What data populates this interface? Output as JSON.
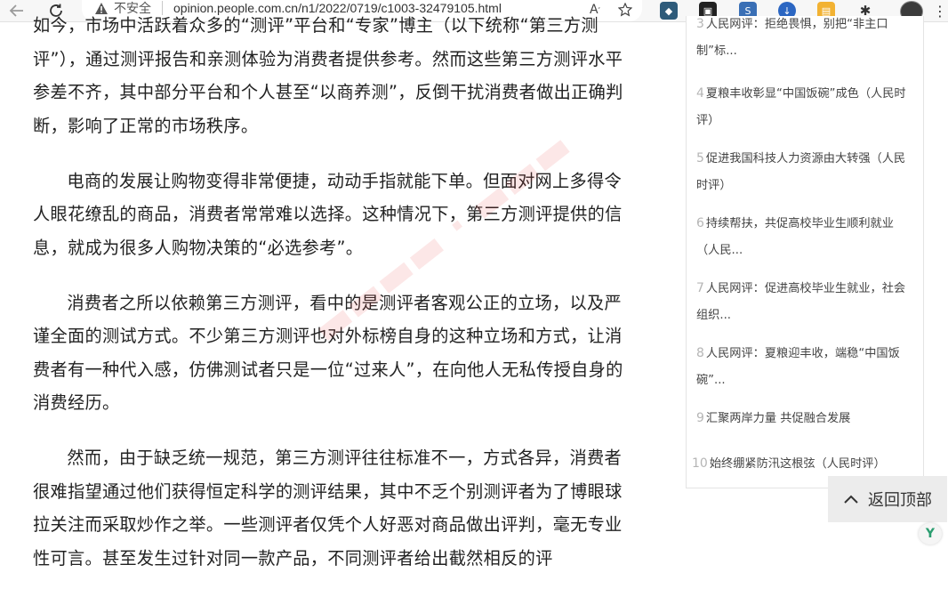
{
  "browser": {
    "security_label": "不安全",
    "url": "opinion.people.com.cn/n1/2022/0719/c1003-32479105.html"
  },
  "article": {
    "paragraphs": [
      "如今，市场中活跃着众多的“测评”平台和“专家”博主（以下统称“第三方测评”），通过测评报告和亲测体验为消费者提供参考。然而这些第三方测评水平参差不齐，其中部分平台和个人甚至“以商养测”，反倒干扰消费者做出正确判断，影响了正常的市场秩序。",
      "电商的发展让购物变得非常便捷，动动手指就能下单。但面对网上多得令人眼花缭乱的商品，消费者常常难以选择。这种情况下，第三方测评提供的信息，就成为很多人购物决策的“必选参考”。",
      "消费者之所以依赖第三方测评，看中的是测评者客观公正的立场，以及严谨全面的测试方式。不少第三方测评也对外标榜自身的这种立场和方式，让消费者有一种代入感，仿佛测试者只是一位“过来人”，在向他人无私传授自身的消费经历。",
      "然而，由于缺乏统一规范，第三方测评往往标准不一，方式各异，消费者很难指望通过他们获得恒定科学的测评结果，其中不乏个别测评者为了博眼球拉关注而采取炒作之举。一些测评者仅凭个人好恶对商品做出评判，毫无专业性可言。甚至发生过针对同一款产品，不同测评者给出截然相反的评"
    ]
  },
  "sidebar": {
    "items": [
      {
        "num": "3",
        "text": "人民网评：拒绝畏惧，别把“非主口制”标..."
      },
      {
        "num": "4",
        "text": "夏粮丰收彰显“中国饭碗”成色（人民时评）"
      },
      {
        "num": "5",
        "text": "促进我国科技人力资源由大转强（人民时评）"
      },
      {
        "num": "6",
        "text": "持续帮扶，共促高校毕业生顺利就业（人民..."
      },
      {
        "num": "7",
        "text": "人民网评：促进高校毕业生就业，社会组织..."
      },
      {
        "num": "8",
        "text": "人民网评：夏粮迎丰收，端稳“中国饭碗”..."
      },
      {
        "num": "9",
        "text": "汇聚两岸力量 共促融合发展"
      },
      {
        "num": "10",
        "text": "始终绷紧防汛这根弦（人民时评）"
      }
    ]
  },
  "back_to_top": "返回顶部"
}
